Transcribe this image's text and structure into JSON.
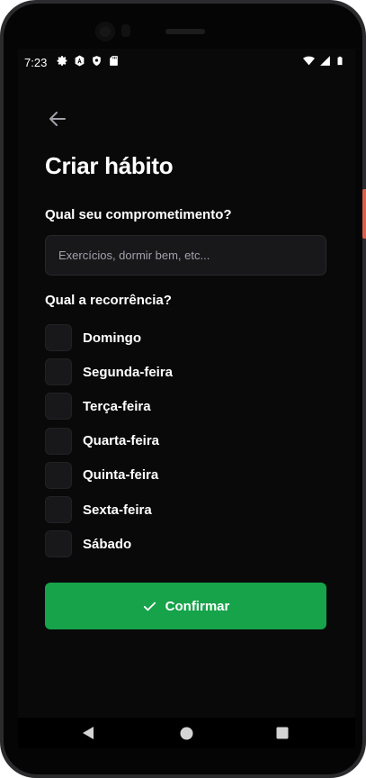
{
  "status_bar": {
    "time": "7:23",
    "left_icons": [
      "gear-icon",
      "a-badge-icon",
      "shield-icon",
      "sd-card-icon"
    ],
    "right_icons": [
      "wifi-icon",
      "signal-icon",
      "battery-icon"
    ]
  },
  "header": {
    "title": "Criar hábito"
  },
  "form": {
    "commitment_label": "Qual seu comprometimento?",
    "commitment_placeholder": "Exercícios, dormir bem, etc...",
    "commitment_value": "",
    "recurrence_label": "Qual a recorrência?",
    "weekdays": [
      {
        "label": "Domingo",
        "checked": false
      },
      {
        "label": "Segunda-feira",
        "checked": false
      },
      {
        "label": "Terça-feira",
        "checked": false
      },
      {
        "label": "Quarta-feira",
        "checked": false
      },
      {
        "label": "Quinta-feira",
        "checked": false
      },
      {
        "label": "Sexta-feira",
        "checked": false
      },
      {
        "label": "Sábado",
        "checked": false
      }
    ],
    "confirm_label": "Confirmar"
  },
  "colors": {
    "background": "#09090a",
    "input_background": "#18181b",
    "accent_green": "#16a34a",
    "text": "#ffffff",
    "placeholder": "#a1a1aa"
  },
  "nav_bar": {
    "buttons": [
      "back-triangle-icon",
      "home-circle-icon",
      "recents-square-icon"
    ]
  }
}
